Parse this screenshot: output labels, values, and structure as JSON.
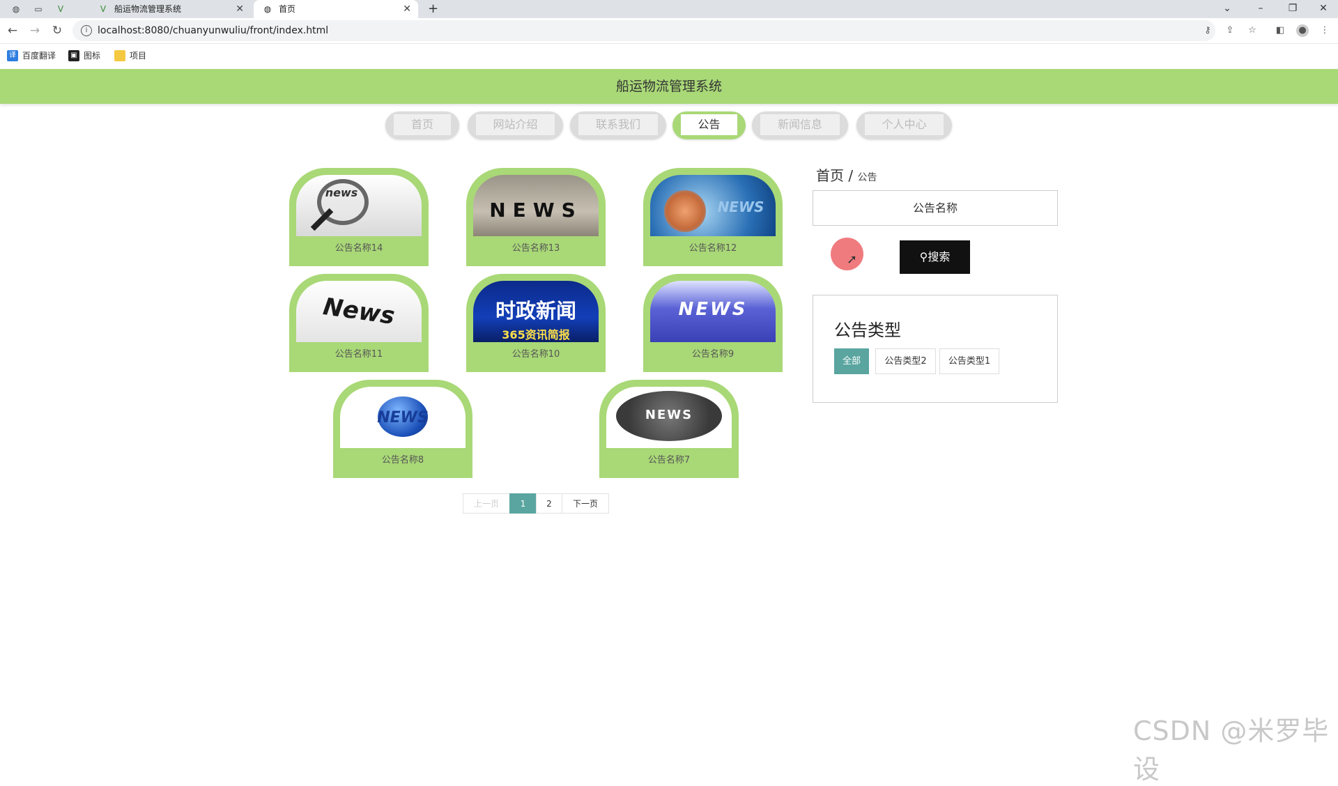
{
  "browser": {
    "tabs": [
      {
        "title": "船运物流管理系统",
        "active": false
      },
      {
        "title": "首页",
        "active": true
      }
    ],
    "url": "localhost:8080/chuanyunwuliu/front/index.html",
    "bookmarks": [
      "百度翻译",
      "图标",
      "项目"
    ],
    "window_controls": {
      "minimize": "–",
      "restore": "❐",
      "close": "✕"
    }
  },
  "site": {
    "title": "船运物流管理系统",
    "menu": [
      {
        "label": "首页",
        "active": false
      },
      {
        "label": "网站介绍",
        "active": false
      },
      {
        "label": "联系我们",
        "active": false
      },
      {
        "label": "公告",
        "active": true
      },
      {
        "label": "新闻信息",
        "active": false
      },
      {
        "label": "个人中心",
        "active": false
      }
    ]
  },
  "notices": [
    {
      "name": "公告名称14",
      "image_text": "news",
      "image_icon": "magnifier-newspaper-image"
    },
    {
      "name": "公告名称13",
      "image_text": "NEWS",
      "image_icon": "news-blocks-image"
    },
    {
      "name": "公告名称12",
      "image_text": "NEWS",
      "image_icon": "globe-news-image"
    },
    {
      "name": "公告名称11",
      "image_text": "News",
      "image_icon": "newspaper-image"
    },
    {
      "name": "公告名称10",
      "image_text": "时政新闻",
      "image_subtext": "365资讯简报",
      "image_icon": "politics-news-image"
    },
    {
      "name": "公告名称9",
      "image_text": "NEWS",
      "image_icon": "keyboard-key-image"
    },
    {
      "name": "公告名称8",
      "image_text": "NEWS",
      "image_icon": "blue-globe-image"
    },
    {
      "name": "公告名称7",
      "image_text": "NEWS",
      "image_icon": "world-badge-image"
    }
  ],
  "pagination": {
    "prev": "上一页",
    "pages": [
      "1",
      "2"
    ],
    "current": "1",
    "next": "下一页"
  },
  "sidebar": {
    "breadcrumb_home": "首页",
    "breadcrumb_sep": "/",
    "breadcrumb_current": "公告",
    "search_placeholder": "公告名称",
    "search_button": "搜索",
    "types_title": "公告类型",
    "types": [
      {
        "label": "全部",
        "active": true
      },
      {
        "label": "公告类型2",
        "active": false
      },
      {
        "label": "公告类型1",
        "active": false
      }
    ]
  },
  "watermark": "CSDN @米罗毕设",
  "colors": {
    "accent_green": "#a9d877",
    "teal": "#5aa5a0"
  }
}
